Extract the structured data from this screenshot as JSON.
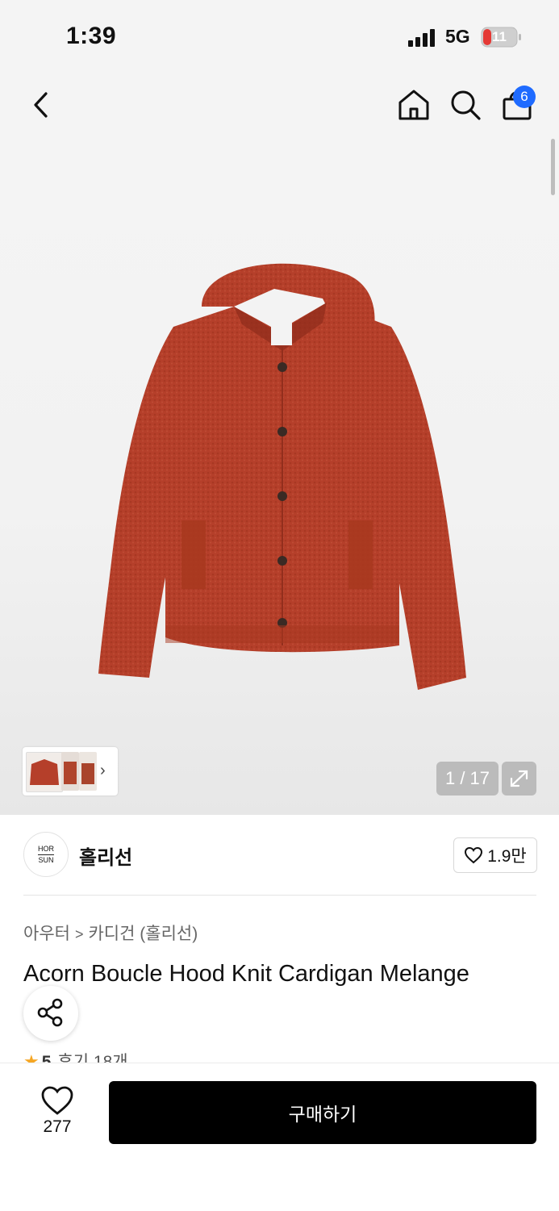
{
  "status_bar": {
    "time": "1:39",
    "network": "5G",
    "battery": "11"
  },
  "nav": {
    "cart_count": "6"
  },
  "gallery": {
    "page_counter": "1 / 17",
    "thumb_next": "›"
  },
  "brand": {
    "logo_line1": "HOR",
    "logo_line2": "SUN",
    "name": "홀리선",
    "likes": "1.9만"
  },
  "breadcrumb": {
    "parent": "아우터",
    "separator": ">",
    "child": "카디건 (홀리선)"
  },
  "product": {
    "title": "Acorn Boucle Hood Knit Cardigan Melange"
  },
  "rating": {
    "star": "★",
    "score": "5",
    "reviews": "후기 18개"
  },
  "bottom_bar": {
    "wishlist_count": "277",
    "buy_label": "구매하기"
  },
  "colors": {
    "accent": "#1f6bff",
    "garment": "#b53f2a",
    "buy_button": "#000000"
  },
  "icons": [
    "chevron-left-icon",
    "home-icon",
    "search-icon",
    "shopping-bag-icon",
    "expand-icon",
    "heart-icon",
    "share-icon",
    "star-icon"
  ]
}
